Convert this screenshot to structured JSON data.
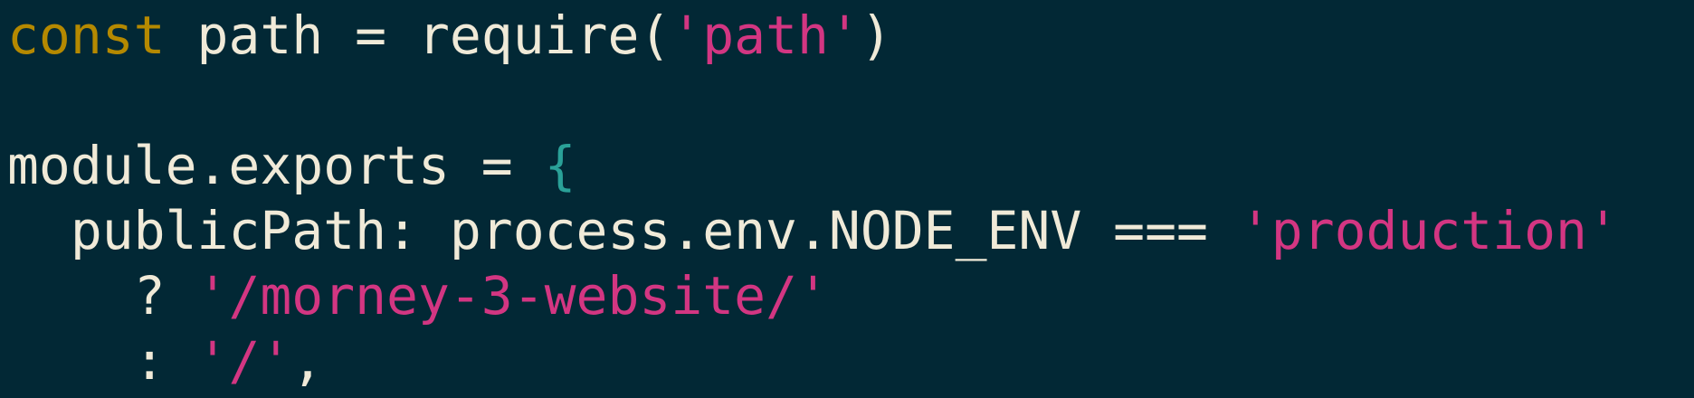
{
  "colors": {
    "background": "#022835",
    "text": "#F0EAD8",
    "keyword": "#B58900",
    "string": "#D33682",
    "brace": "#2AA198"
  },
  "code": {
    "line1": {
      "keyword": "const",
      "text": " path = require(",
      "string": "'path'",
      "close": ")"
    },
    "line2": {
      "text": "module.exports = ",
      "brace": "{"
    },
    "line3": {
      "indent": "  ",
      "text": "publicPath: process.env.NODE_ENV === ",
      "string": "'production'"
    },
    "line4": {
      "indent": "    ",
      "op": "? ",
      "string": "'/morney-3-website/'"
    },
    "line5": {
      "indent": "    ",
      "op": ": ",
      "string": "'/'",
      "punct": ","
    }
  }
}
